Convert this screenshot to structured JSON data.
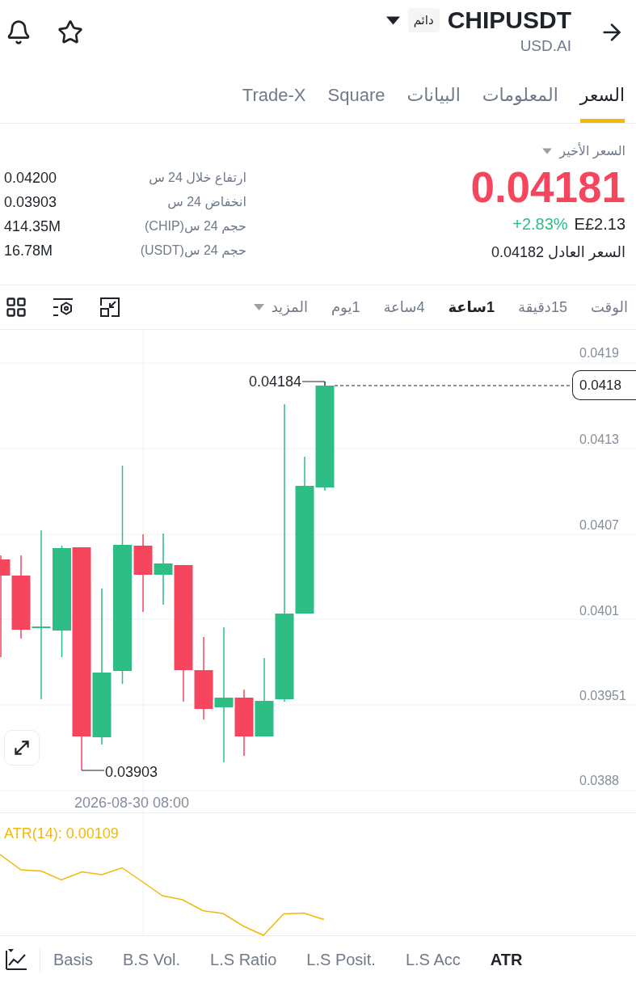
{
  "header": {
    "title": "CHIPUSDT",
    "badge": "دائم",
    "subtitle": "USD.AI"
  },
  "tabs": [
    {
      "label": "السعر",
      "selected": true
    },
    {
      "label": "المعلومات",
      "selected": false
    },
    {
      "label": "البيانات",
      "selected": false
    },
    {
      "label": "Square",
      "selected": false
    },
    {
      "label": "Trade-X",
      "selected": false
    }
  ],
  "price": {
    "label": "السعر الأخير",
    "last": "0.04181",
    "change": "+2.83%",
    "local": "E£2.13",
    "fair": "السعر العادل 0.04182"
  },
  "stats": [
    {
      "label": "ارتفاع خلال 24 س",
      "value": "0.04200"
    },
    {
      "label": "انخفاض 24 س",
      "value": "0.03903"
    },
    {
      "label": "حجم 24 س(CHIP)",
      "value": "414.35M"
    },
    {
      "label": "حجم 24 س(USDT)",
      "value": "16.78M"
    }
  ],
  "intervals": [
    {
      "label": "الوقت",
      "selected": false,
      "kind": "option"
    },
    {
      "label": "15دقيقة",
      "selected": false,
      "kind": "option"
    },
    {
      "label": "1ساعة",
      "selected": true,
      "kind": "option"
    },
    {
      "label": "4ساعة",
      "selected": false,
      "kind": "option"
    },
    {
      "label": "1يوم",
      "selected": false,
      "kind": "option"
    },
    {
      "label": "المزيد",
      "selected": false,
      "kind": "dropdown"
    }
  ],
  "chart": {
    "price_ticks": [
      "0.0419",
      "0.0413",
      "0.0407",
      "0.0401",
      "0.03951",
      "0.0388"
    ],
    "current_price": "0.0418",
    "high_label": "0.04184",
    "low_label": "0.03903",
    "time_label": "2026-08-30 08:00"
  },
  "indicator": {
    "label": "ATR(14): 0.00109"
  },
  "indicator_tabs": [
    {
      "label": "ATR",
      "selected": true
    },
    {
      "label": "L.S Acc",
      "selected": false
    },
    {
      "label": "L.S Posit.",
      "selected": false
    },
    {
      "label": "L.S Ratio",
      "selected": false
    },
    {
      "label": "B.S Vol.",
      "selected": false
    },
    {
      "label": "Basis",
      "selected": false
    }
  ]
}
